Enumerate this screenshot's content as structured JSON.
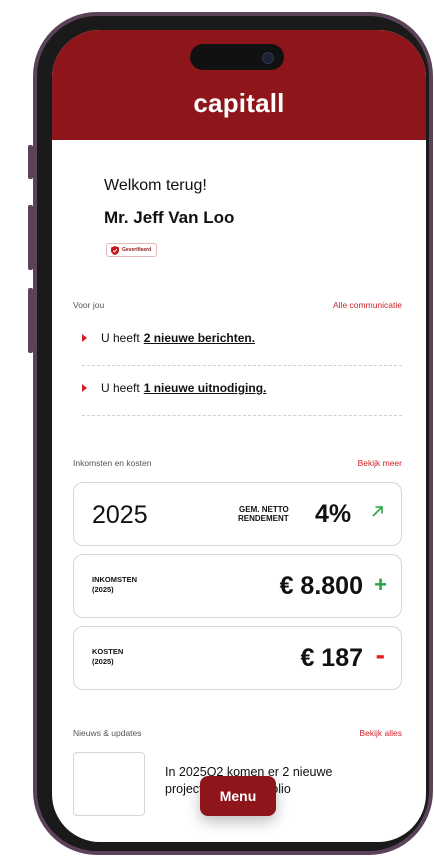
{
  "app": {
    "brand": "capitall"
  },
  "greeting": {
    "welcome": "Welkom terug!",
    "name": "Mr. Jeff Van Loo",
    "badge": "Geverifieerd"
  },
  "for_you": {
    "label": "Voor jou",
    "link": "Alle communicatie",
    "messages": [
      {
        "prefix": "U heeft",
        "link": "2 nieuwe berichten."
      },
      {
        "prefix": "U heeft",
        "link": "1 nieuwe uitnodiging."
      }
    ]
  },
  "income": {
    "label": "Inkomsten en kosten",
    "link": "Bekijk meer",
    "year": "2025",
    "return_label_1": "GEM. NETTO",
    "return_label_2": "RENDEMENT",
    "return_value": "4%",
    "income_label_1": "INKOMSTEN",
    "income_label_2": "(2025)",
    "income_value": "€ 8.800",
    "income_sign": "+",
    "costs_label_1": "KOSTEN",
    "costs_label_2": "(2025)",
    "costs_value": "€ 187",
    "costs_sign": "-"
  },
  "news": {
    "label": "Nieuws & updates",
    "link": "Bekijk alles",
    "item_text": "In 2025Q2 komen er 2 nieuwe projecten in je portfolio"
  },
  "menu": {
    "label": "Menu"
  },
  "colors": {
    "brand": "#8e161b",
    "accent_link": "#d31f26",
    "positive": "#22a43a",
    "negative": "#e21d24"
  },
  "icons": [
    "shield-check-icon",
    "bullet-arrow-icon",
    "trend-up-arrow-icon"
  ]
}
